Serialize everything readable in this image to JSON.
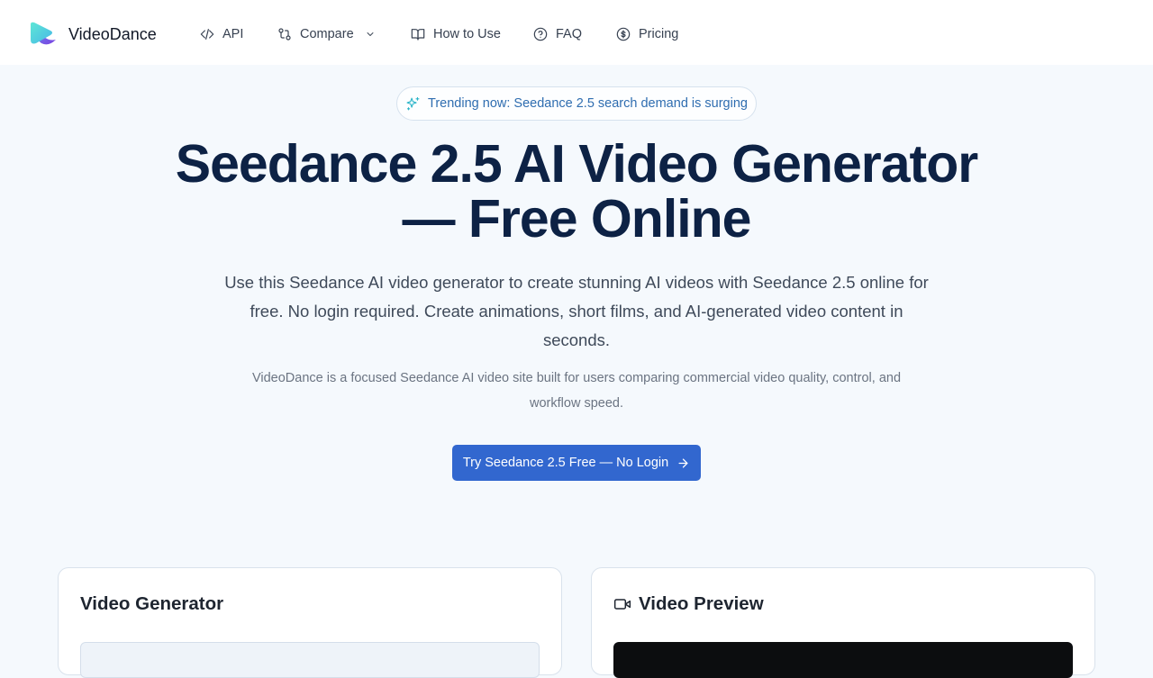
{
  "brand": {
    "name": "VideoDance"
  },
  "nav": {
    "api": "API",
    "compare": "Compare",
    "how_to_use": "How to Use",
    "faq": "FAQ",
    "pricing": "Pricing"
  },
  "hero": {
    "trend": "Trending now: Seedance 2.5 search demand is surging",
    "title_line1": "Seedance 2.5 AI Video Generator",
    "title_line2": "— Free Online",
    "subtitle": "Use this Seedance AI video generator to create stunning AI videos with Seedance 2.5 online for free. No login required. Create animations, short films, and AI-generated video content in seconds.",
    "note": "VideoDance is a focused Seedance AI video site built for users comparing commercial video quality, control, and workflow speed.",
    "cta": "Try Seedance 2.5 Free — No Login"
  },
  "panels": {
    "generator_title": "Video Generator",
    "preview_title": "Video Preview"
  },
  "colors": {
    "accent": "#3267cf",
    "title": "#0d2245",
    "trend_text": "#2f6db0",
    "trend_icon": "#2bb4c8",
    "page_bg": "#f5f9fd"
  },
  "icons": {
    "api": "code-icon",
    "compare": "compare-icon",
    "how_to_use": "book-icon",
    "faq": "help-circle-icon",
    "pricing": "dollar-circle-icon",
    "trend": "sparkles-icon",
    "cta": "arrow-right-icon",
    "preview": "video-camera-icon"
  }
}
